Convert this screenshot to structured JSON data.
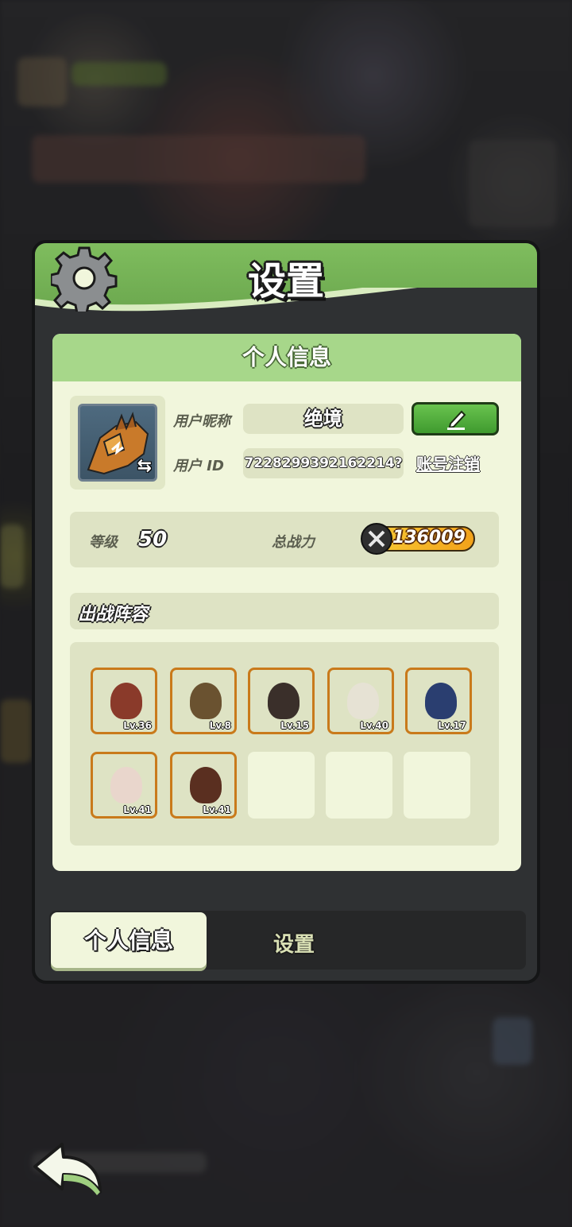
{
  "header": {
    "title": "设置",
    "icon": "gear-icon"
  },
  "profile_card": {
    "section_title": "个人信息",
    "nickname_label": "用户昵称",
    "nickname_value": "绝境",
    "id_label": "用户  ID",
    "id_value": "7228299392162214?",
    "edit_icon": "pencil-icon",
    "cancel_account_link": "账号注销",
    "avatar_icon": "swap-arrows-icon"
  },
  "stats": {
    "level_label": "等级",
    "level_value": "50",
    "power_label": "总战力",
    "power_value": "136009"
  },
  "team": {
    "title": "出战阵容",
    "heroes": [
      {
        "level": "Lv.36",
        "color": "#8a3a2a"
      },
      {
        "level": "Lv.8",
        "color": "#6a5230"
      },
      {
        "level": "Lv.15",
        "color": "#3a2f2a"
      },
      {
        "level": "Lv.40",
        "color": "#5a5a55"
      },
      {
        "level": "Lv.17",
        "color": "#2a3e70"
      },
      {
        "level": "Lv.41",
        "color": "#6e4d3e"
      },
      {
        "level": "Lv.41",
        "color": "#5a2f20"
      }
    ],
    "empty_slots": 3
  },
  "tabs": [
    {
      "label": "个人信息",
      "active": true
    },
    {
      "label": "设置",
      "active": false
    }
  ],
  "back_icon": "back-arrow-icon",
  "colors": {
    "header_green": "#7fbd5e",
    "card_bg": "#f1f6dc",
    "hero_border": "#c97a1b"
  }
}
